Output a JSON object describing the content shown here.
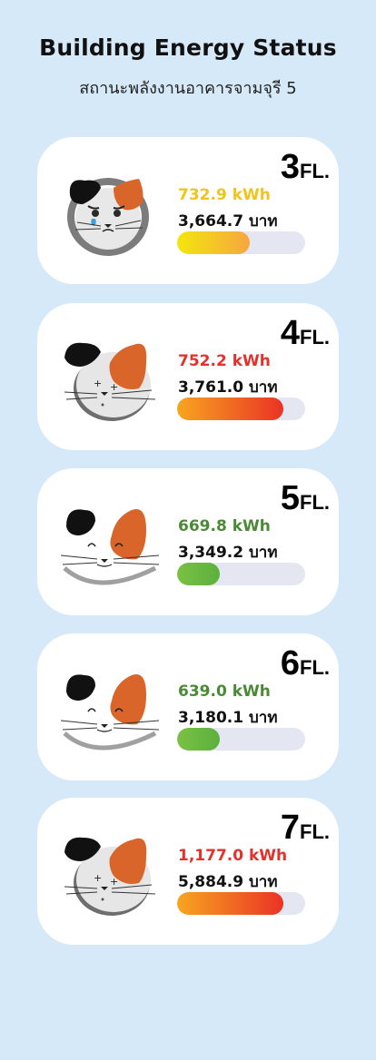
{
  "header": {
    "title": "Building Energy Status",
    "subtitle": "สถานะพลังงานอาคารจามจุรี 5"
  },
  "floors": [
    {
      "floor": "3",
      "suffix": "FL.",
      "kwh": "732.9 kWh",
      "baht": "3,664.7 บาท",
      "level": 0.57,
      "status": "medium",
      "kwh_color": "#f2c31a",
      "bar_from": "#f4e60c",
      "bar_to": "#f6a640",
      "cat_icon": "cat-crying-icon"
    },
    {
      "floor": "4",
      "suffix": "FL.",
      "kwh": "752.2 kWh",
      "baht": "3,761.0 บาท",
      "level": 0.83,
      "status": "high",
      "kwh_color": "#e3312b",
      "bar_from": "#f7a520",
      "bar_to": "#ea3325",
      "cat_icon": "cat-dizzy-icon"
    },
    {
      "floor": "5",
      "suffix": "FL.",
      "kwh": "669.8 kWh",
      "baht": "3,349.2 บาท",
      "level": 0.33,
      "status": "low",
      "kwh_color": "#4a8a34",
      "bar_from": "#7ac143",
      "bar_to": "#5cb03e",
      "cat_icon": "cat-happy-icon"
    },
    {
      "floor": "6",
      "suffix": "FL.",
      "kwh": "639.0 kWh",
      "baht": "3,180.1 บาท",
      "level": 0.33,
      "status": "low",
      "kwh_color": "#4a8a34",
      "bar_from": "#7ac143",
      "bar_to": "#5cb03e",
      "cat_icon": "cat-happy-icon"
    },
    {
      "floor": "7",
      "suffix": "FL.",
      "kwh": "1,177.0 kWh",
      "baht": "5,884.9 บาท",
      "level": 0.83,
      "status": "high",
      "kwh_color": "#e3312b",
      "bar_from": "#f7a520",
      "bar_to": "#ea3325",
      "cat_icon": "cat-dizzy-icon"
    }
  ]
}
